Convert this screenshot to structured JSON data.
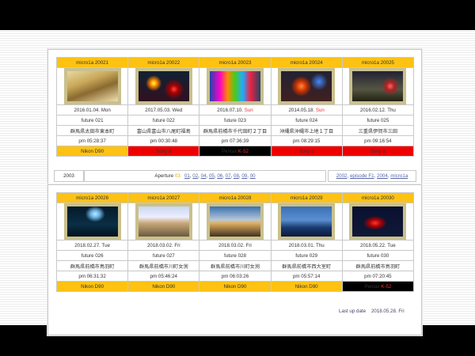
{
  "top_row": [
    {
      "title": "micro1a 20021",
      "date": "2016.01.04.",
      "day": "Mon",
      "day_sun": false,
      "future": "future 021",
      "location": "群馬県太田市東本町",
      "time": "pm 05:28:37",
      "camera_a": "Nikon D90",
      "camera_b": "",
      "camera_style": "nikon",
      "photo": "ph1"
    },
    {
      "title": "micro1a 20022",
      "date": "2017.05.03.",
      "day": "Wed",
      "day_sun": false,
      "future": "future 022",
      "location": "富山県富山市八尾町福島",
      "time": "pm 00:30:48",
      "camera_a": "Sony ",
      "camera_b": "α",
      "camera_style": "sony",
      "photo": "ph2"
    },
    {
      "title": "micro1a 20023",
      "date": "2016.07.10.",
      "day": "Sun",
      "day_sun": true,
      "future": "future 023",
      "location": "群馬県前橋市千代田町２丁目",
      "time": "pm 07:36:39",
      "camera_a": "Pentax ",
      "camera_b": "K-52",
      "camera_style": "pentax",
      "photo": "ph3"
    },
    {
      "title": "micro1a 20024",
      "date": "2014.05.18.",
      "day": "Sun",
      "day_sun": true,
      "future": "future 024",
      "location": "沖縄県沖縄市上地１丁目",
      "time": "pm 08:29:15",
      "camera_a": "Sony ",
      "camera_b": "α",
      "camera_style": "sony",
      "photo": "ph4"
    },
    {
      "title": "micro1a 20025",
      "date": "2016.02.12.",
      "day": "Thu",
      "day_sun": false,
      "future": "future 025",
      "location": "三重県伊賀市三田",
      "time": "pm 09:16:54",
      "camera_a": "Sony ",
      "camera_b": "α",
      "camera_style": "sony",
      "photo": "ph5"
    }
  ],
  "bottom_row": [
    {
      "title": "micro1a 20026",
      "date": "2018.02.27.",
      "day": "Tue",
      "day_sun": false,
      "future": "future 026",
      "location": "群馬県前橋市鳥羽町",
      "time": "pm 06:31:32",
      "camera_a": "Nikon D90",
      "camera_b": "",
      "camera_style": "nikon",
      "photo": "ph6"
    },
    {
      "title": "micro1a 20027",
      "date": "2018.03.02.",
      "day": "Fri",
      "day_sun": false,
      "future": "future 027",
      "location": "群馬県前橋市川町女渕",
      "time": "pm 05:46:24",
      "camera_a": "Nikon D90",
      "camera_b": "",
      "camera_style": "nikon",
      "photo": "ph7"
    },
    {
      "title": "micro1a 20028",
      "date": "2018.03.02.",
      "day": "Fri",
      "day_sun": false,
      "future": "future 028",
      "location": "群馬県前橋市川町女渕",
      "time": "pm 06:03:26",
      "camera_a": "Nikon D90",
      "camera_b": "",
      "camera_style": "nikon",
      "photo": "ph8"
    },
    {
      "title": "micro1a 20029",
      "date": "2018.03.01.",
      "day": "Thu",
      "day_sun": false,
      "future": "future 029",
      "location": "群馬県前橋市西大室町",
      "time": "pm 05:57:14",
      "camera_a": "Nikon D90",
      "camera_b": "",
      "camera_style": "nikon",
      "photo": "ph9"
    },
    {
      "title": "micro1a 20030",
      "date": "2018.05.22.",
      "day": "Tue",
      "day_sun": false,
      "future": "future 030",
      "location": "群馬県前橋市鳥羽町",
      "time": "pm 07:20:45",
      "camera_a": "Pentax ",
      "camera_b": "K-52",
      "camera_style": "pentax",
      "photo": "ph10"
    }
  ],
  "nav": {
    "year": "2003",
    "aperture_label": "Aperture",
    "aperture_current": "03",
    "pages": [
      "01",
      "02",
      "04",
      "05",
      "06",
      "07",
      "08",
      "09",
      "00"
    ],
    "right_links": [
      "2002",
      "episode F1",
      "2004",
      "micro1a"
    ]
  },
  "footer": {
    "label": "Last up date",
    "date": "2018.05.28.",
    "day": "Fri"
  },
  "colors": {
    "header": "#fdc214",
    "nikon": "#fdc214",
    "sony": "#ee0000",
    "pentax": "#000000",
    "sunday": "#e33333"
  }
}
